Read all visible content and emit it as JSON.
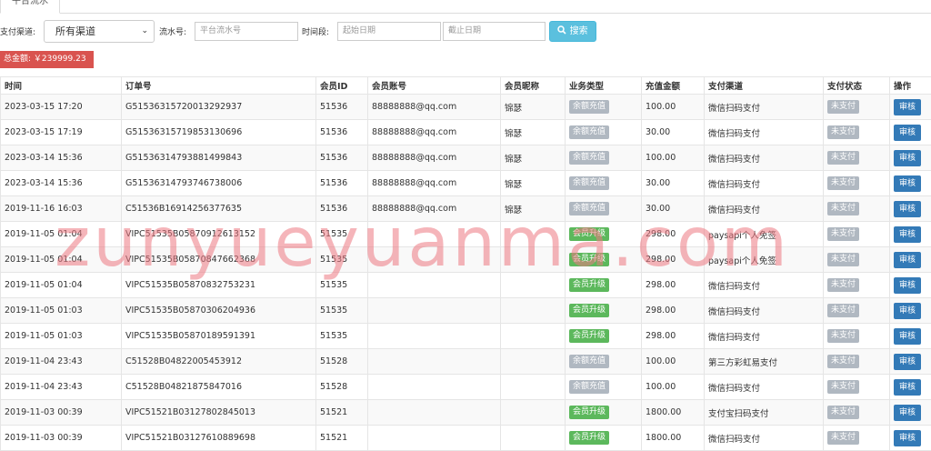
{
  "tab": {
    "label": "平台流水"
  },
  "filters": {
    "channel_label": "支付渠道:",
    "channel_value": "所有渠道",
    "serial_label": "流水号:",
    "serial_placeholder": "平台流水号",
    "time_label": "时间段:",
    "start_placeholder": "起始日期",
    "end_placeholder": "截止日期",
    "search_label": "搜索"
  },
  "total": {
    "text": "总金额: ￥239999.23"
  },
  "table": {
    "headers": [
      "时间",
      "订单号",
      "会员ID",
      "会员账号",
      "会员昵称",
      "业务类型",
      "充值金额",
      "支付渠道",
      "支付状态",
      "操作"
    ],
    "action_label": "审核",
    "rows": [
      {
        "time": "2023-03-15 17:20",
        "order": "G51536315720013292937",
        "uid": "51536",
        "account": "88888888@qq.com",
        "nick": "锦瑟",
        "type": "余额充值",
        "type_color": "gray",
        "amount": "100.00",
        "channel": "微信扫码支付",
        "status": "未支付"
      },
      {
        "time": "2023-03-15 17:19",
        "order": "G51536315719853130696",
        "uid": "51536",
        "account": "88888888@qq.com",
        "nick": "锦瑟",
        "type": "余额充值",
        "type_color": "gray",
        "amount": "30.00",
        "channel": "微信扫码支付",
        "status": "未支付"
      },
      {
        "time": "2023-03-14 15:36",
        "order": "G51536314793881499843",
        "uid": "51536",
        "account": "88888888@qq.com",
        "nick": "锦瑟",
        "type": "余额充值",
        "type_color": "gray",
        "amount": "100.00",
        "channel": "微信扫码支付",
        "status": "未支付"
      },
      {
        "time": "2023-03-14 15:36",
        "order": "G51536314793746738006",
        "uid": "51536",
        "account": "88888888@qq.com",
        "nick": "锦瑟",
        "type": "余额充值",
        "type_color": "gray",
        "amount": "30.00",
        "channel": "微信扫码支付",
        "status": "未支付"
      },
      {
        "time": "2019-11-16 16:03",
        "order": "C51536B16914256377635",
        "uid": "51536",
        "account": "88888888@qq.com",
        "nick": "锦瑟",
        "type": "余额充值",
        "type_color": "gray",
        "amount": "30.00",
        "channel": "微信扫码支付",
        "status": "未支付"
      },
      {
        "time": "2019-11-05 01:04",
        "order": "VIPC51535B05870912613152",
        "uid": "51535",
        "account": "",
        "nick": "",
        "type": "会员升级",
        "type_color": "green",
        "amount": "298.00",
        "channel": "paysapi个人免签",
        "status": "未支付"
      },
      {
        "time": "2019-11-05 01:04",
        "order": "VIPC51535B05870847662368",
        "uid": "51535",
        "account": "",
        "nick": "",
        "type": "会员升级",
        "type_color": "green",
        "amount": "298.00",
        "channel": "paysapi个人免签",
        "status": "未支付"
      },
      {
        "time": "2019-11-05 01:04",
        "order": "VIPC51535B05870832753231",
        "uid": "51535",
        "account": "",
        "nick": "",
        "type": "会员升级",
        "type_color": "green",
        "amount": "298.00",
        "channel": "微信扫码支付",
        "status": "未支付"
      },
      {
        "time": "2019-11-05 01:03",
        "order": "VIPC51535B05870306204936",
        "uid": "51535",
        "account": "",
        "nick": "",
        "type": "会员升级",
        "type_color": "green",
        "amount": "298.00",
        "channel": "微信扫码支付",
        "status": "未支付"
      },
      {
        "time": "2019-11-05 01:03",
        "order": "VIPC51535B05870189591391",
        "uid": "51535",
        "account": "",
        "nick": "",
        "type": "会员升级",
        "type_color": "green",
        "amount": "298.00",
        "channel": "微信扫码支付",
        "status": "未支付"
      },
      {
        "time": "2019-11-04 23:43",
        "order": "C51528B04822005453912",
        "uid": "51528",
        "account": "",
        "nick": "",
        "type": "余额充值",
        "type_color": "gray",
        "amount": "100.00",
        "channel": "第三方彩虹易支付",
        "status": "未支付"
      },
      {
        "time": "2019-11-04 23:43",
        "order": "C51528B04821875847016",
        "uid": "51528",
        "account": "",
        "nick": "",
        "type": "余额充值",
        "type_color": "gray",
        "amount": "100.00",
        "channel": "微信扫码支付",
        "status": "未支付"
      },
      {
        "time": "2019-11-03 00:39",
        "order": "VIPC51521B03127802845013",
        "uid": "51521",
        "account": "",
        "nick": "",
        "type": "会员升级",
        "type_color": "green",
        "amount": "1800.00",
        "channel": "支付宝扫码支付",
        "status": "未支付"
      },
      {
        "time": "2019-11-03 00:39",
        "order": "VIPC51521B03127610889698",
        "uid": "51521",
        "account": "",
        "nick": "",
        "type": "会员升级",
        "type_color": "green",
        "amount": "1800.00",
        "channel": "微信扫码支付",
        "status": "未支付"
      }
    ]
  },
  "watermark": {
    "text": "zunyueyuanma.com"
  }
}
